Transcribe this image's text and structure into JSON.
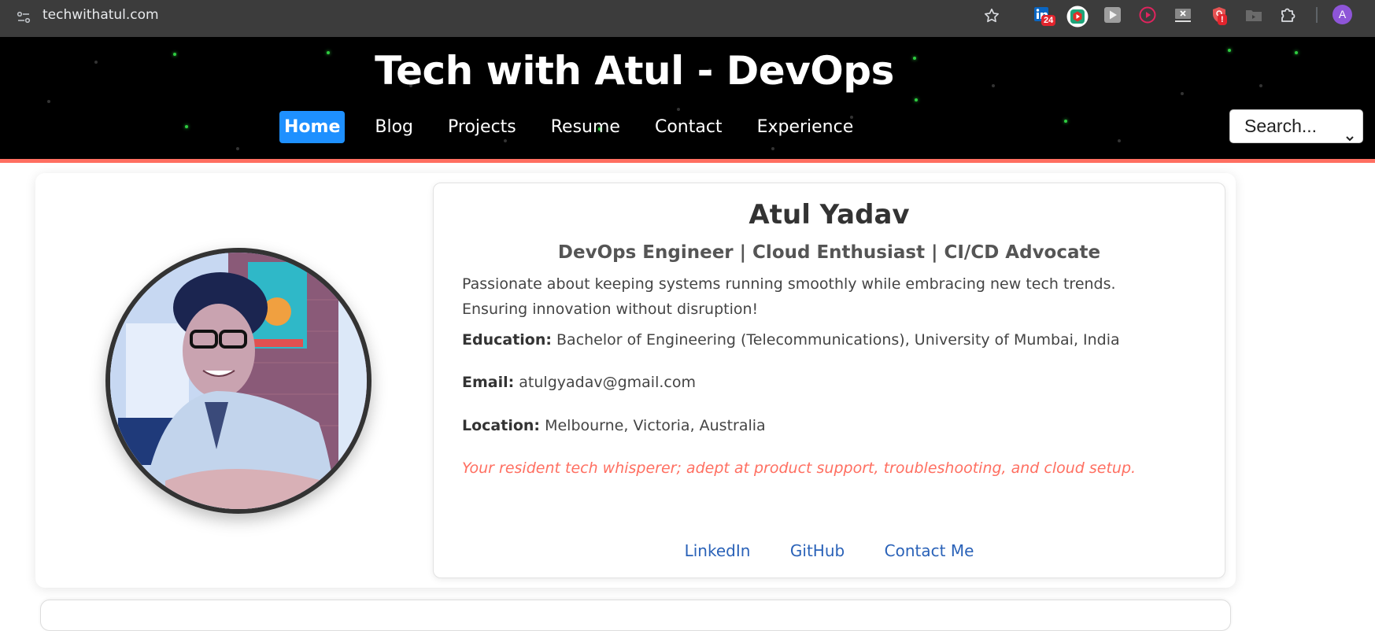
{
  "browser": {
    "url": "techwithatul.com",
    "extensions": [
      {
        "name": "linkedin-extension",
        "badge": "24"
      },
      {
        "name": "video-extension"
      },
      {
        "name": "play-extension"
      },
      {
        "name": "media-player-extension"
      },
      {
        "name": "close-tab-extension"
      },
      {
        "name": "security-extension",
        "badge": "!"
      },
      {
        "name": "folder-video-extension"
      },
      {
        "name": "puzzle-extensions"
      }
    ],
    "profile_initial": "A"
  },
  "header": {
    "title": "Tech with Atul - DevOps",
    "nav": [
      {
        "label": "Home",
        "active": true
      },
      {
        "label": "Blog"
      },
      {
        "label": "Projects"
      },
      {
        "label": "Resume"
      },
      {
        "label": "Contact"
      },
      {
        "label": "Experience"
      }
    ],
    "search_select": {
      "selected": "Search..."
    }
  },
  "profile": {
    "name": "Atul Yadav",
    "tagline": "DevOps Engineer | Cloud Enthusiast | CI/CD Advocate",
    "bio": "Passionate about keeping systems running smoothly while embracing new tech trends. Ensuring innovation without disruption!",
    "education_label": "Education:",
    "education": "Bachelor of Engineering (Telecommunications), University of Mumbai, India",
    "email_label": "Email:",
    "email": "atulgyadav@gmail.com",
    "location_label": "Location:",
    "location": "Melbourne, Victoria, Australia",
    "quote": "Your resident tech whisperer; adept at product support, troubleshooting, and cloud setup.",
    "links": [
      {
        "label": "LinkedIn"
      },
      {
        "label": "GitHub"
      },
      {
        "label": "Contact Me"
      }
    ]
  },
  "colors": {
    "accent": "#ff6f61",
    "nav_active": "#1e90ff",
    "link": "#2a62b8",
    "header_bg": "#000000",
    "chrome_bg": "#3c3c3c"
  }
}
